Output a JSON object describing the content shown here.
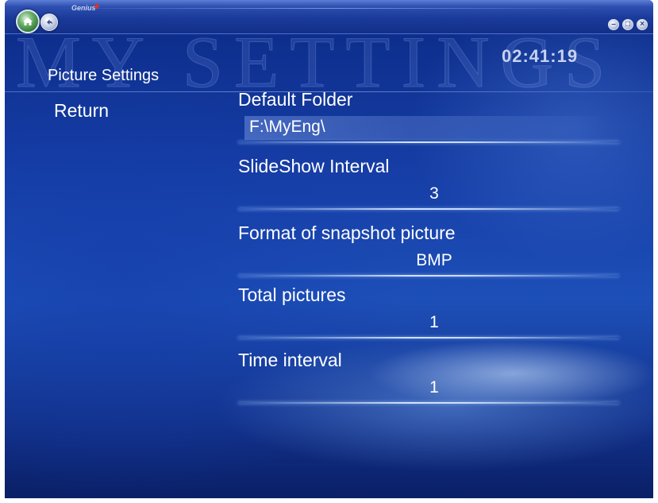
{
  "titlebar": {
    "logo_text": "Genius",
    "buttons": {
      "home_icon": "home-icon",
      "back_icon": "back-arrow-icon",
      "minimize_icon": "minimize-icon",
      "maximize_icon": "maximize-icon",
      "close_icon": "close-icon"
    }
  },
  "header": {
    "watermark": "MY SETTINGS",
    "clock": "02:41:19",
    "page_title": "Picture Settings"
  },
  "nav": {
    "return_label": "Return"
  },
  "settings": [
    {
      "label": "Default Folder",
      "value": "F:\\MyEng\\"
    },
    {
      "label": "SlideShow Interval",
      "value": "3"
    },
    {
      "label": "Format of snapshot picture",
      "value": "BMP"
    },
    {
      "label": "Total pictures",
      "value": "1"
    },
    {
      "label": "Time interval",
      "value": "1"
    }
  ],
  "colors": {
    "background": "#1d4fb8",
    "text": "#ffffff",
    "clock": "#c7d2ef"
  }
}
